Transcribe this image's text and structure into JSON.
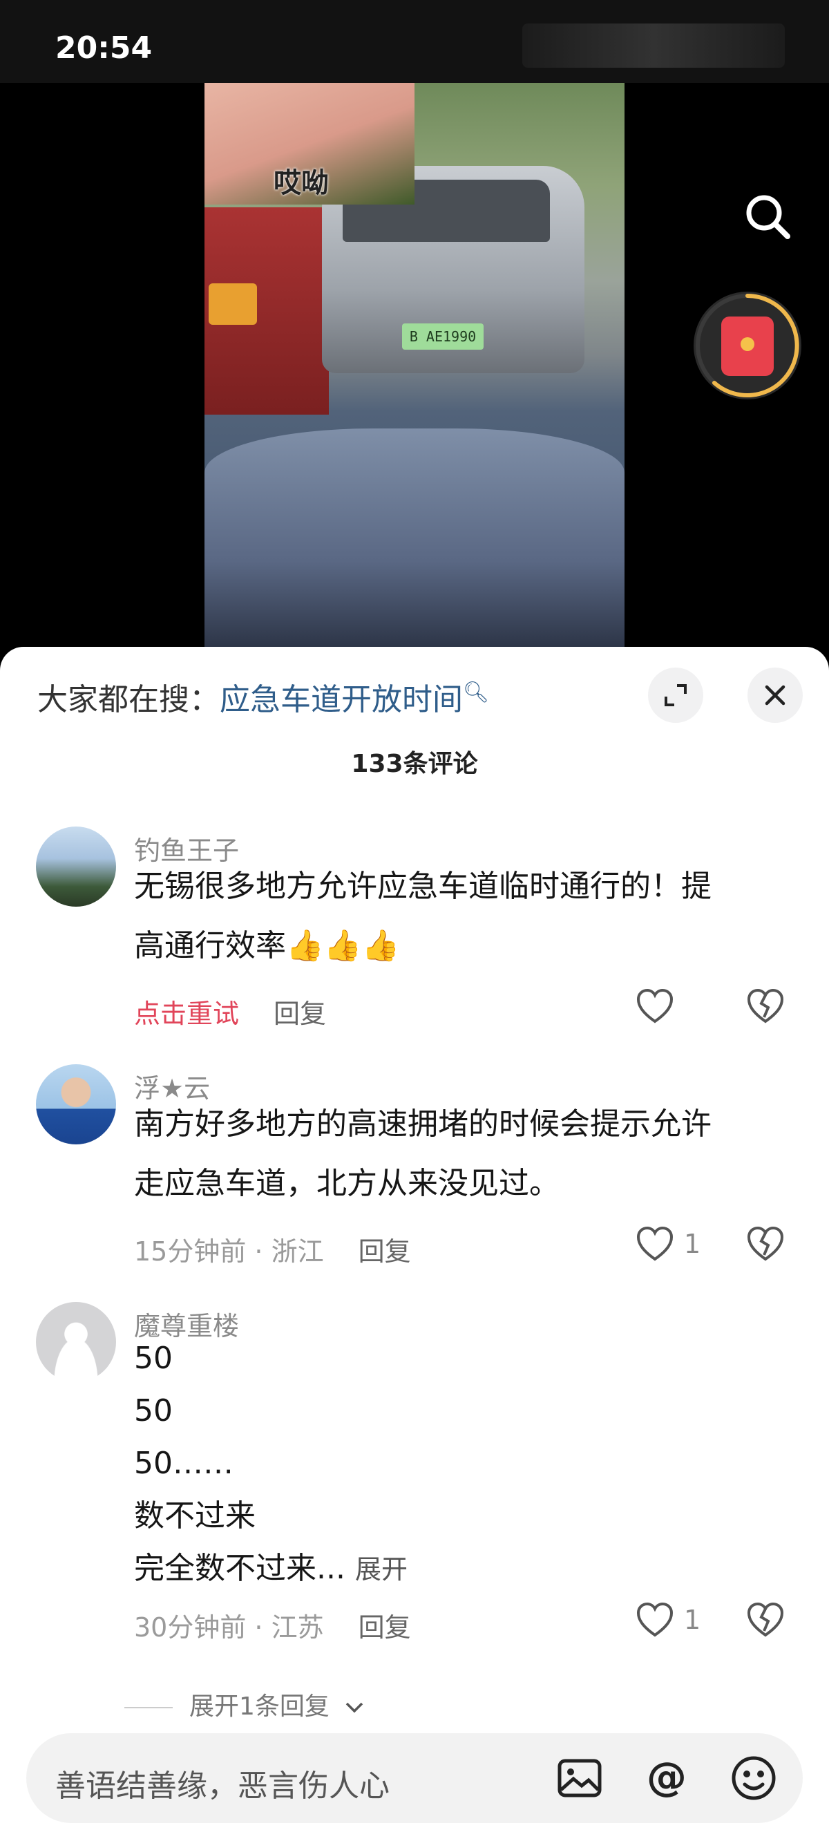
{
  "status_bar": {
    "time": "20:54"
  },
  "video": {
    "sticker_text": "哎呦",
    "plate_text": "B AE1990"
  },
  "panel": {
    "hot_search_label": "大家都在搜：",
    "hot_search_keyword": "应急车道开放时间",
    "comment_count": "133条评论"
  },
  "comments": [
    {
      "username": "钓鱼王子",
      "lines": [
        "无锡很多地方允许应急车道临时通行的！提",
        "高通行效率👍👍👍"
      ],
      "status": "点击重试",
      "reply_label": "回复",
      "likes": ""
    },
    {
      "username": "浮★云",
      "lines": [
        "南方好多地方的高速拥堵的时候会提示允许",
        "走应急车道，北方从来没见过。"
      ],
      "time_location": "15分钟前 · 浙江",
      "reply_label": "回复",
      "likes": "1"
    },
    {
      "username": "魔尊重楼",
      "lines": [
        "50",
        "50",
        "50……",
        "数不过来",
        "完全数不过来..."
      ],
      "expand_label": "展开",
      "time_location": "30分钟前 · 江苏",
      "reply_label": "回复",
      "likes": "1",
      "more_replies": "展开1条回复"
    }
  ],
  "input": {
    "placeholder": "善语结善缘，恶言伤人心"
  },
  "icons": {
    "search": "search-icon",
    "red_packet": "red-packet-icon",
    "expand": "expand-icon",
    "close": "close-icon",
    "like": "heart-icon",
    "dislike": "broken-heart-icon",
    "image": "image-icon",
    "at": "at-icon",
    "emoji": "emoji-icon"
  },
  "colors": {
    "accent_red": "#e1455a",
    "keyword_blue": "#2f5d8a"
  }
}
